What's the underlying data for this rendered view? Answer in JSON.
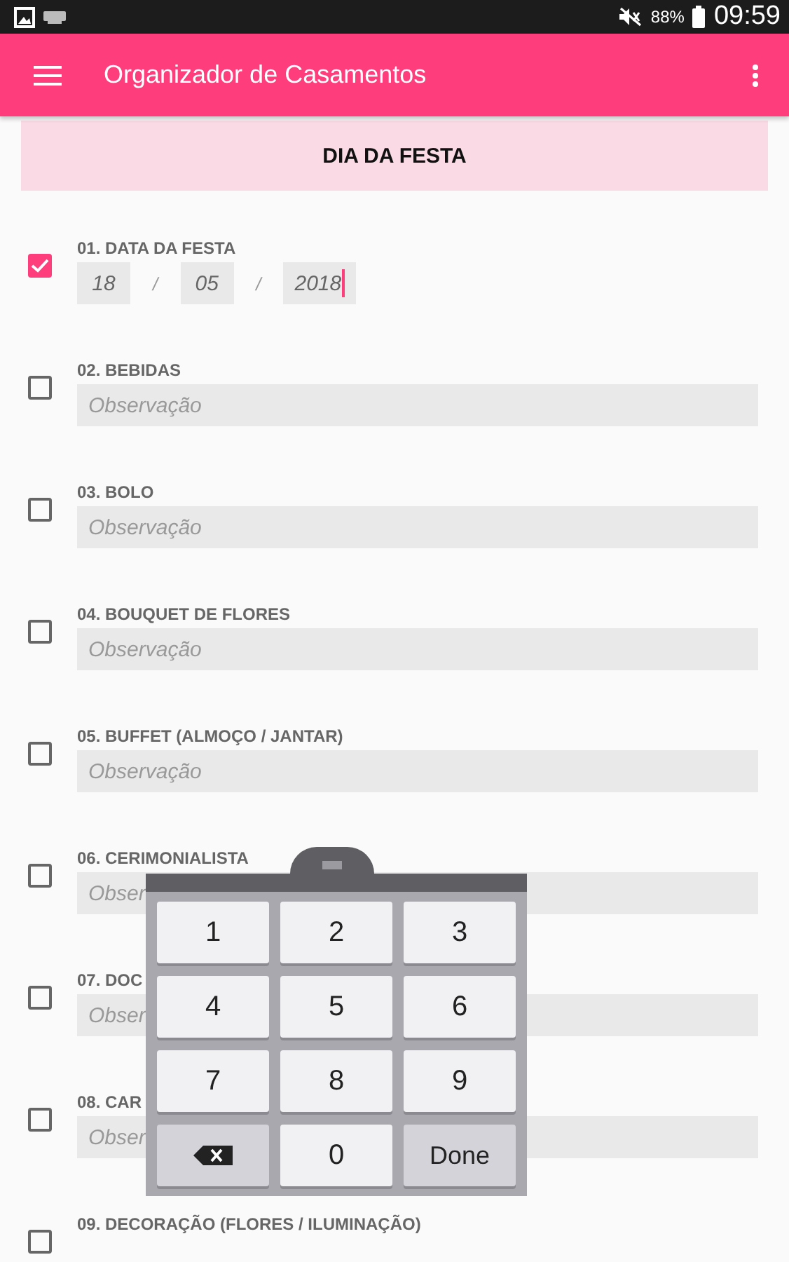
{
  "status_bar": {
    "battery": "88%",
    "time": "09:59"
  },
  "app_bar": {
    "title": "Organizador de Casamentos"
  },
  "section": {
    "title": "DIA DA FESTA"
  },
  "items": [
    {
      "kind": "date",
      "label": "01. DATA DA FESTA",
      "checked": true,
      "date_parts": [
        {
          "value": "18",
          "focused": false
        },
        {
          "value": "05",
          "focused": false
        },
        {
          "value": "2018",
          "focused": true
        }
      ],
      "separators": [
        "/",
        "/"
      ]
    },
    {
      "kind": "note",
      "label": "02. BEBIDAS",
      "checked": false,
      "placeholder": "Observação"
    },
    {
      "kind": "note",
      "label": "03. BOLO",
      "checked": false,
      "placeholder": "Observação"
    },
    {
      "kind": "note",
      "label": "04. BOUQUET DE FLORES",
      "checked": false,
      "placeholder": "Observação"
    },
    {
      "kind": "note",
      "label": "05. BUFFET (ALMOÇO / JANTAR)",
      "checked": false,
      "placeholder": "Observação"
    },
    {
      "kind": "note",
      "label": "06. CERIMONIALISTA",
      "checked": false,
      "placeholder": "Obser"
    },
    {
      "kind": "note",
      "label": "07. DOC",
      "checked": false,
      "placeholder": "Obser"
    },
    {
      "kind": "note",
      "label": "08. CAR",
      "checked": false,
      "placeholder": "Obser"
    },
    {
      "kind": "label_only",
      "label": "09. DECORAÇÃO (FLORES / ILUMINAÇÃO)",
      "checked": false
    }
  ],
  "keyboard": {
    "keys": [
      {
        "kind": "digit",
        "label": "1"
      },
      {
        "kind": "digit",
        "label": "2"
      },
      {
        "kind": "digit",
        "label": "3"
      },
      {
        "kind": "digit",
        "label": "4"
      },
      {
        "kind": "digit",
        "label": "5"
      },
      {
        "kind": "digit",
        "label": "6"
      },
      {
        "kind": "digit",
        "label": "7"
      },
      {
        "kind": "digit",
        "label": "8"
      },
      {
        "kind": "digit",
        "label": "9"
      },
      {
        "kind": "backspace"
      },
      {
        "kind": "digit",
        "label": "0"
      },
      {
        "kind": "done",
        "label": "Done"
      }
    ]
  }
}
